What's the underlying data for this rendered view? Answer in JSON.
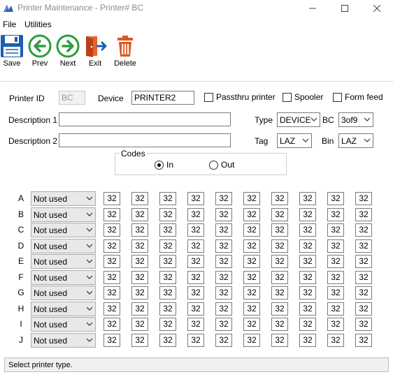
{
  "window": {
    "title": "Printer Maintenance - Printer# BC"
  },
  "menu": {
    "items": [
      "File",
      "Utilities"
    ]
  },
  "toolbar": {
    "save": "Save",
    "prev": "Prev",
    "next": "Next",
    "exit": "Exit",
    "delete": "Delete"
  },
  "form": {
    "printer_id_label": "Printer ID",
    "printer_id_value": "BC",
    "device_label": "Device",
    "device_value": "PRINTER2",
    "passthru_label": "Passthru printer",
    "spooler_label": "Spooler",
    "formfeed_label": "Form feed",
    "desc1_label": "Description 1",
    "desc1_value": "",
    "desc2_label": "Description 2",
    "desc2_value": "",
    "type_label": "Type",
    "type_value": "DEVICE",
    "bc_label": "BC",
    "bc_value": "3of9",
    "tag_label": "Tag",
    "tag_value": "LAZ",
    "bin_label": "Bin",
    "bin_value": "LAZ"
  },
  "codes": {
    "title": "Codes",
    "in_label": "In",
    "out_label": "Out",
    "selected": "In"
  },
  "grid": {
    "rows": [
      {
        "letter": "A",
        "select": "Not used",
        "values": [
          "32",
          "32",
          "32",
          "32",
          "32",
          "32",
          "32",
          "32",
          "32",
          "32"
        ]
      },
      {
        "letter": "B",
        "select": "Not used",
        "values": [
          "32",
          "32",
          "32",
          "32",
          "32",
          "32",
          "32",
          "32",
          "32",
          "32"
        ]
      },
      {
        "letter": "C",
        "select": "Not used",
        "values": [
          "32",
          "32",
          "32",
          "32",
          "32",
          "32",
          "32",
          "32",
          "32",
          "32"
        ]
      },
      {
        "letter": "D",
        "select": "Not used",
        "values": [
          "32",
          "32",
          "32",
          "32",
          "32",
          "32",
          "32",
          "32",
          "32",
          "32"
        ]
      },
      {
        "letter": "E",
        "select": "Not used",
        "values": [
          "32",
          "32",
          "32",
          "32",
          "32",
          "32",
          "32",
          "32",
          "32",
          "32"
        ]
      },
      {
        "letter": "F",
        "select": "Not used",
        "values": [
          "32",
          "32",
          "32",
          "32",
          "32",
          "32",
          "32",
          "32",
          "32",
          "32"
        ]
      },
      {
        "letter": "G",
        "select": "Not used",
        "values": [
          "32",
          "32",
          "32",
          "32",
          "32",
          "32",
          "32",
          "32",
          "32",
          "32"
        ]
      },
      {
        "letter": "H",
        "select": "Not used",
        "values": [
          "32",
          "32",
          "32",
          "32",
          "32",
          "32",
          "32",
          "32",
          "32",
          "32"
        ]
      },
      {
        "letter": "I",
        "select": "Not used",
        "values": [
          "32",
          "32",
          "32",
          "32",
          "32",
          "32",
          "32",
          "32",
          "32",
          "32"
        ]
      },
      {
        "letter": "J",
        "select": "Not used",
        "values": [
          "32",
          "32",
          "32",
          "32",
          "32",
          "32",
          "32",
          "32",
          "32",
          "32"
        ]
      }
    ]
  },
  "status": {
    "text": "Select printer type."
  },
  "colors": {
    "save_blue": "#1a5fb4",
    "nav_green": "#2e9d3e",
    "exit_orange": "#e8622a",
    "delete_orange": "#e2571e"
  }
}
